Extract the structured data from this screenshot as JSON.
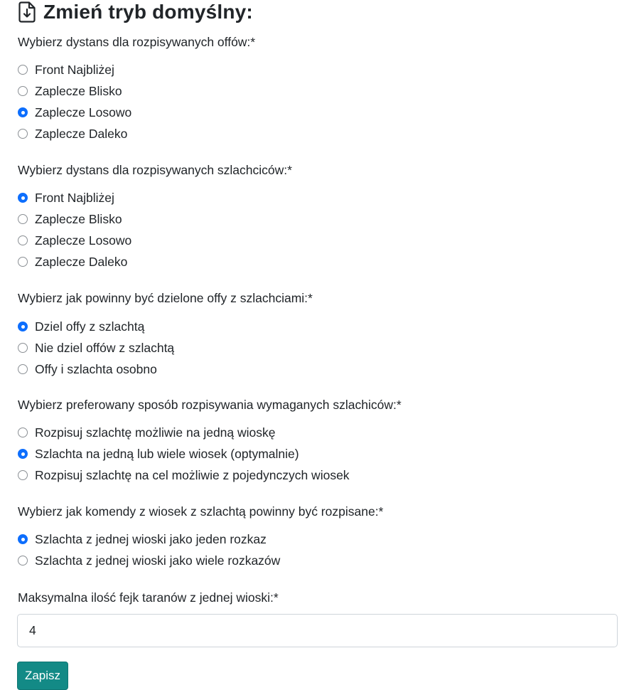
{
  "page": {
    "title": "Zmień tryb domyślny:",
    "title_icon": "file-download-icon"
  },
  "groups": [
    {
      "label": "Wybierz dystans dla rozpisywanych offów:*",
      "options": [
        {
          "label": "Front Najbliżej",
          "checked": false
        },
        {
          "label": "Zaplecze Blisko",
          "checked": false
        },
        {
          "label": "Zaplecze Losowo",
          "checked": true
        },
        {
          "label": "Zaplecze Daleko",
          "checked": false
        }
      ]
    },
    {
      "label": "Wybierz dystans dla rozpisywanych szlachciców:*",
      "options": [
        {
          "label": "Front Najbliżej",
          "checked": true
        },
        {
          "label": "Zaplecze Blisko",
          "checked": false
        },
        {
          "label": "Zaplecze Losowo",
          "checked": false
        },
        {
          "label": "Zaplecze Daleko",
          "checked": false
        }
      ]
    },
    {
      "label": "Wybierz jak powinny być dzielone offy z szlachciami:*",
      "options": [
        {
          "label": "Dziel offy z szlachtą",
          "checked": true
        },
        {
          "label": "Nie dziel offów z szlachtą",
          "checked": false
        },
        {
          "label": "Offy i szlachta osobno",
          "checked": false
        }
      ]
    },
    {
      "label": "Wybierz preferowany sposób rozpisywania wymaganych szlachiców:*",
      "options": [
        {
          "label": "Rozpisuj szlachtę możliwie na jedną wioskę",
          "checked": false
        },
        {
          "label": "Szlachta na jedną lub wiele wiosek (optymalnie)",
          "checked": true
        },
        {
          "label": "Rozpisuj szlachtę na cel możliwie z pojedynczych wiosek",
          "checked": false
        }
      ]
    },
    {
      "label": "Wybierz jak komendy z wiosek z szlachtą powinny być rozpisane:*",
      "options": [
        {
          "label": "Szlachta z jednej wioski jako jeden rozkaz",
          "checked": true
        },
        {
          "label": "Szlachta z jednej wioski jako wiele rozkazów",
          "checked": false
        }
      ]
    }
  ],
  "fake_rams": {
    "label": "Maksymalna ilość fejk taranów z jednej wioski:*",
    "value": "4"
  },
  "save_button": {
    "label": "Zapisz",
    "color": "#138a86"
  },
  "colors": {
    "radio_checked": "#0d6efd"
  }
}
